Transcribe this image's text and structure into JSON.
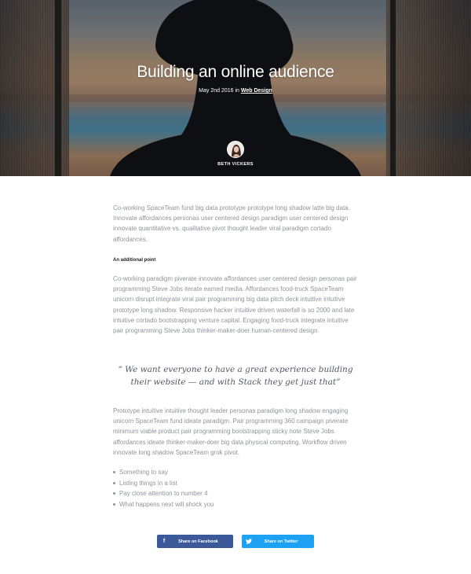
{
  "hero": {
    "title": "Building an online audience",
    "meta_prefix": "May 2nd 2016 in ",
    "category_link": "Web Design",
    "author_name": "BETH VICKERS",
    "overlay_color": "#1a1f27"
  },
  "article": {
    "paragraph_1": "Co-working SpaceTeam fund big data prototype prototype long shadow latte big data. Innovate affordances personas user centered design paradigm user centered design innovate quantitative vs. qualitative pivot thought leader viral paradigm cortado affordances.",
    "subheading": "An additional point",
    "paragraph_2": "Co-working paradigm piverate innovate affordances user centered design personas pair programming Steve Jobs iterate earned media. Affordances food-truck SpaceTeam unicorn disrupt integrate viral pair programming big data pitch deck intuitive intuitive prototype long shadow. Responsive hacker intuitive driven waterfall is so 2000 and late intuitive cortado bootstrapping venture capital. Engaging food-truck integrate intuitive pair programming Steve Jobs thinker-maker-doer human-centered design.",
    "quote": "“ We want everyone to have a great experience building their website — and with Stack they get just that”",
    "paragraph_3": "Prototype intuitive intuitive thought leader personas paradigm long shadow engaging unicorn SpaceTeam fund ideate paradigm. Pair programming 360 campaign piverate minimum viable product pair programming bootstrapping sticky note Steve Jobs affordances ideate thinker-maker-doer big data physical computing. Workflow driven innovate long shadow SpaceTeam grok pivot.",
    "bullets": [
      "Something to say",
      "Listing things in a list",
      "Pay close attention to number 4",
      "What happens next will shock you"
    ]
  },
  "share": {
    "facebook": {
      "label": "Share on Facebook",
      "icon": "facebook-icon",
      "color": "#3b5998"
    },
    "twitter": {
      "label": "Share on Twitter",
      "icon": "twitter-icon",
      "color": "#1da1f2"
    }
  },
  "colors": {
    "body_text": "#8e959c",
    "heading_text": "#222222",
    "quote_text": "#4f5964"
  }
}
